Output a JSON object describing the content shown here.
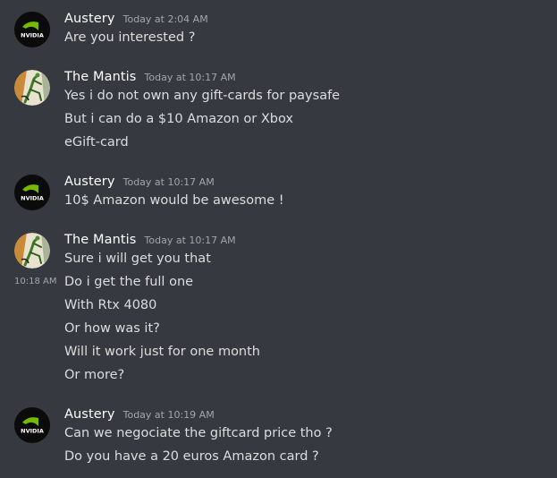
{
  "messages": [
    {
      "author": "Austery",
      "timestamp": "Today at 2:04 AM",
      "avatar_icon": "nvidia-logo-avatar",
      "lines": [
        "Are you interested ?"
      ]
    },
    {
      "author": "The Mantis",
      "timestamp": "Today at 10:17 AM",
      "avatar_icon": "mantis-avatar",
      "lines": [
        "Yes i do not own any gift-cards for paysafe",
        "But i can do a $10 Amazon or Xbox",
        "eGift-card"
      ]
    },
    {
      "author": "Austery",
      "timestamp": "Today at 10:17 AM",
      "avatar_icon": "nvidia-logo-avatar",
      "lines": [
        "10$ Amazon would be awesome !"
      ]
    },
    {
      "author": "The Mantis",
      "timestamp": "Today at 10:17 AM",
      "avatar_icon": "mantis-avatar",
      "hover_time": "10:18 AM",
      "lines": [
        "Sure i will get you that",
        "Do i get the full one",
        "With Rtx 4080",
        "Or how was it?",
        "Will it work just for one month",
        "Or more?"
      ]
    },
    {
      "author": "Austery",
      "timestamp": "Today at 10:19 AM",
      "avatar_icon": "nvidia-logo-avatar",
      "lines": [
        "Can we negociate the giftcard price tho ?",
        "Do you have a 20 euros Amazon card ?"
      ]
    }
  ],
  "nvidia_logo_text": "NVIDIA",
  "colors": {
    "background": "#36393f",
    "username": "#ffffff",
    "message_text": "#dcddde",
    "timestamp": "#a3a6aa",
    "nvidia_green": "#76b900"
  }
}
